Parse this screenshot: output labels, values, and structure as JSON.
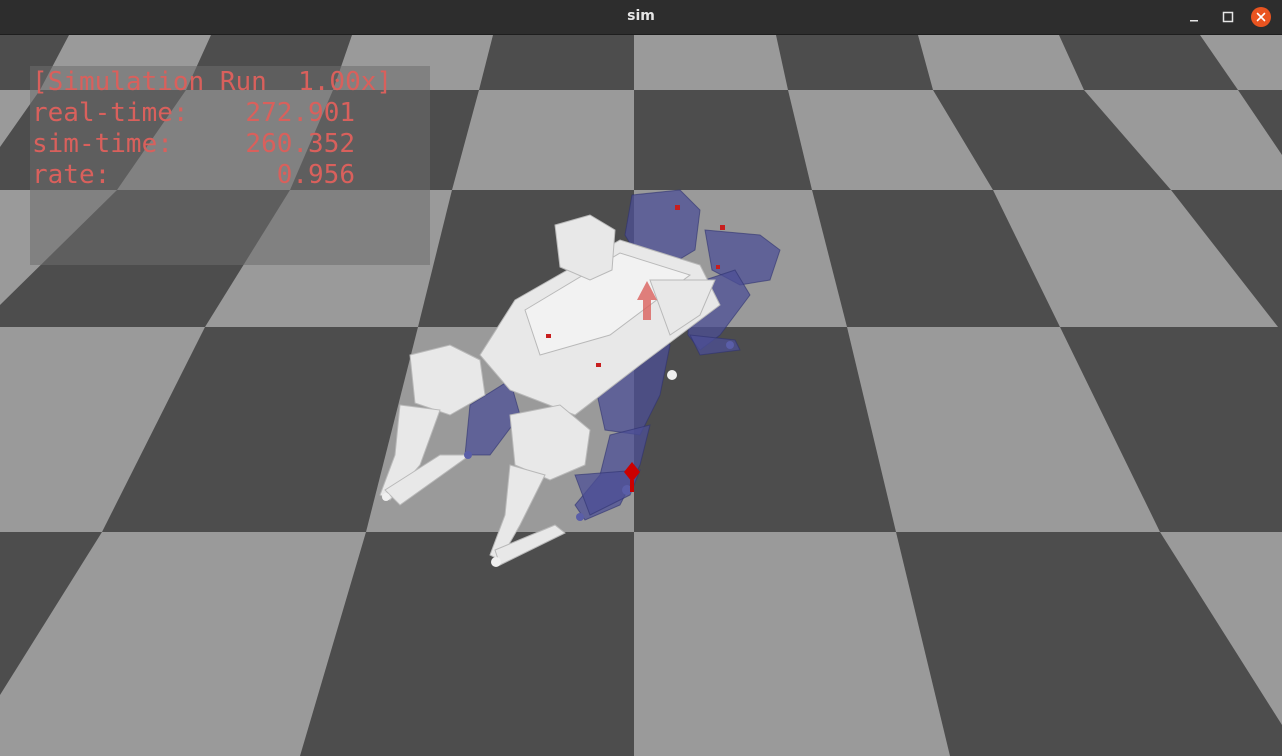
{
  "window": {
    "title": "sim"
  },
  "overlay": {
    "header": "[Simulation Run  1.00x]",
    "rows": [
      {
        "label": "real-time:",
        "value": "272.901"
      },
      {
        "label": "sim-time:",
        "value": "260.352"
      },
      {
        "label": "rate:",
        "value": "0.956"
      }
    ]
  },
  "colors": {
    "overlay_text": "#d9605c",
    "floor_light": "#9a9a9a",
    "floor_dark": "#4d4d4d",
    "robot_white": "#e8e8e8",
    "robot_ghost": "#4c4f96",
    "marker_red": "#c81e1e",
    "close_button": "#e95420"
  },
  "icons": {
    "minimize": "minimize-icon",
    "maximize": "maximize-icon",
    "close": "close-icon"
  }
}
